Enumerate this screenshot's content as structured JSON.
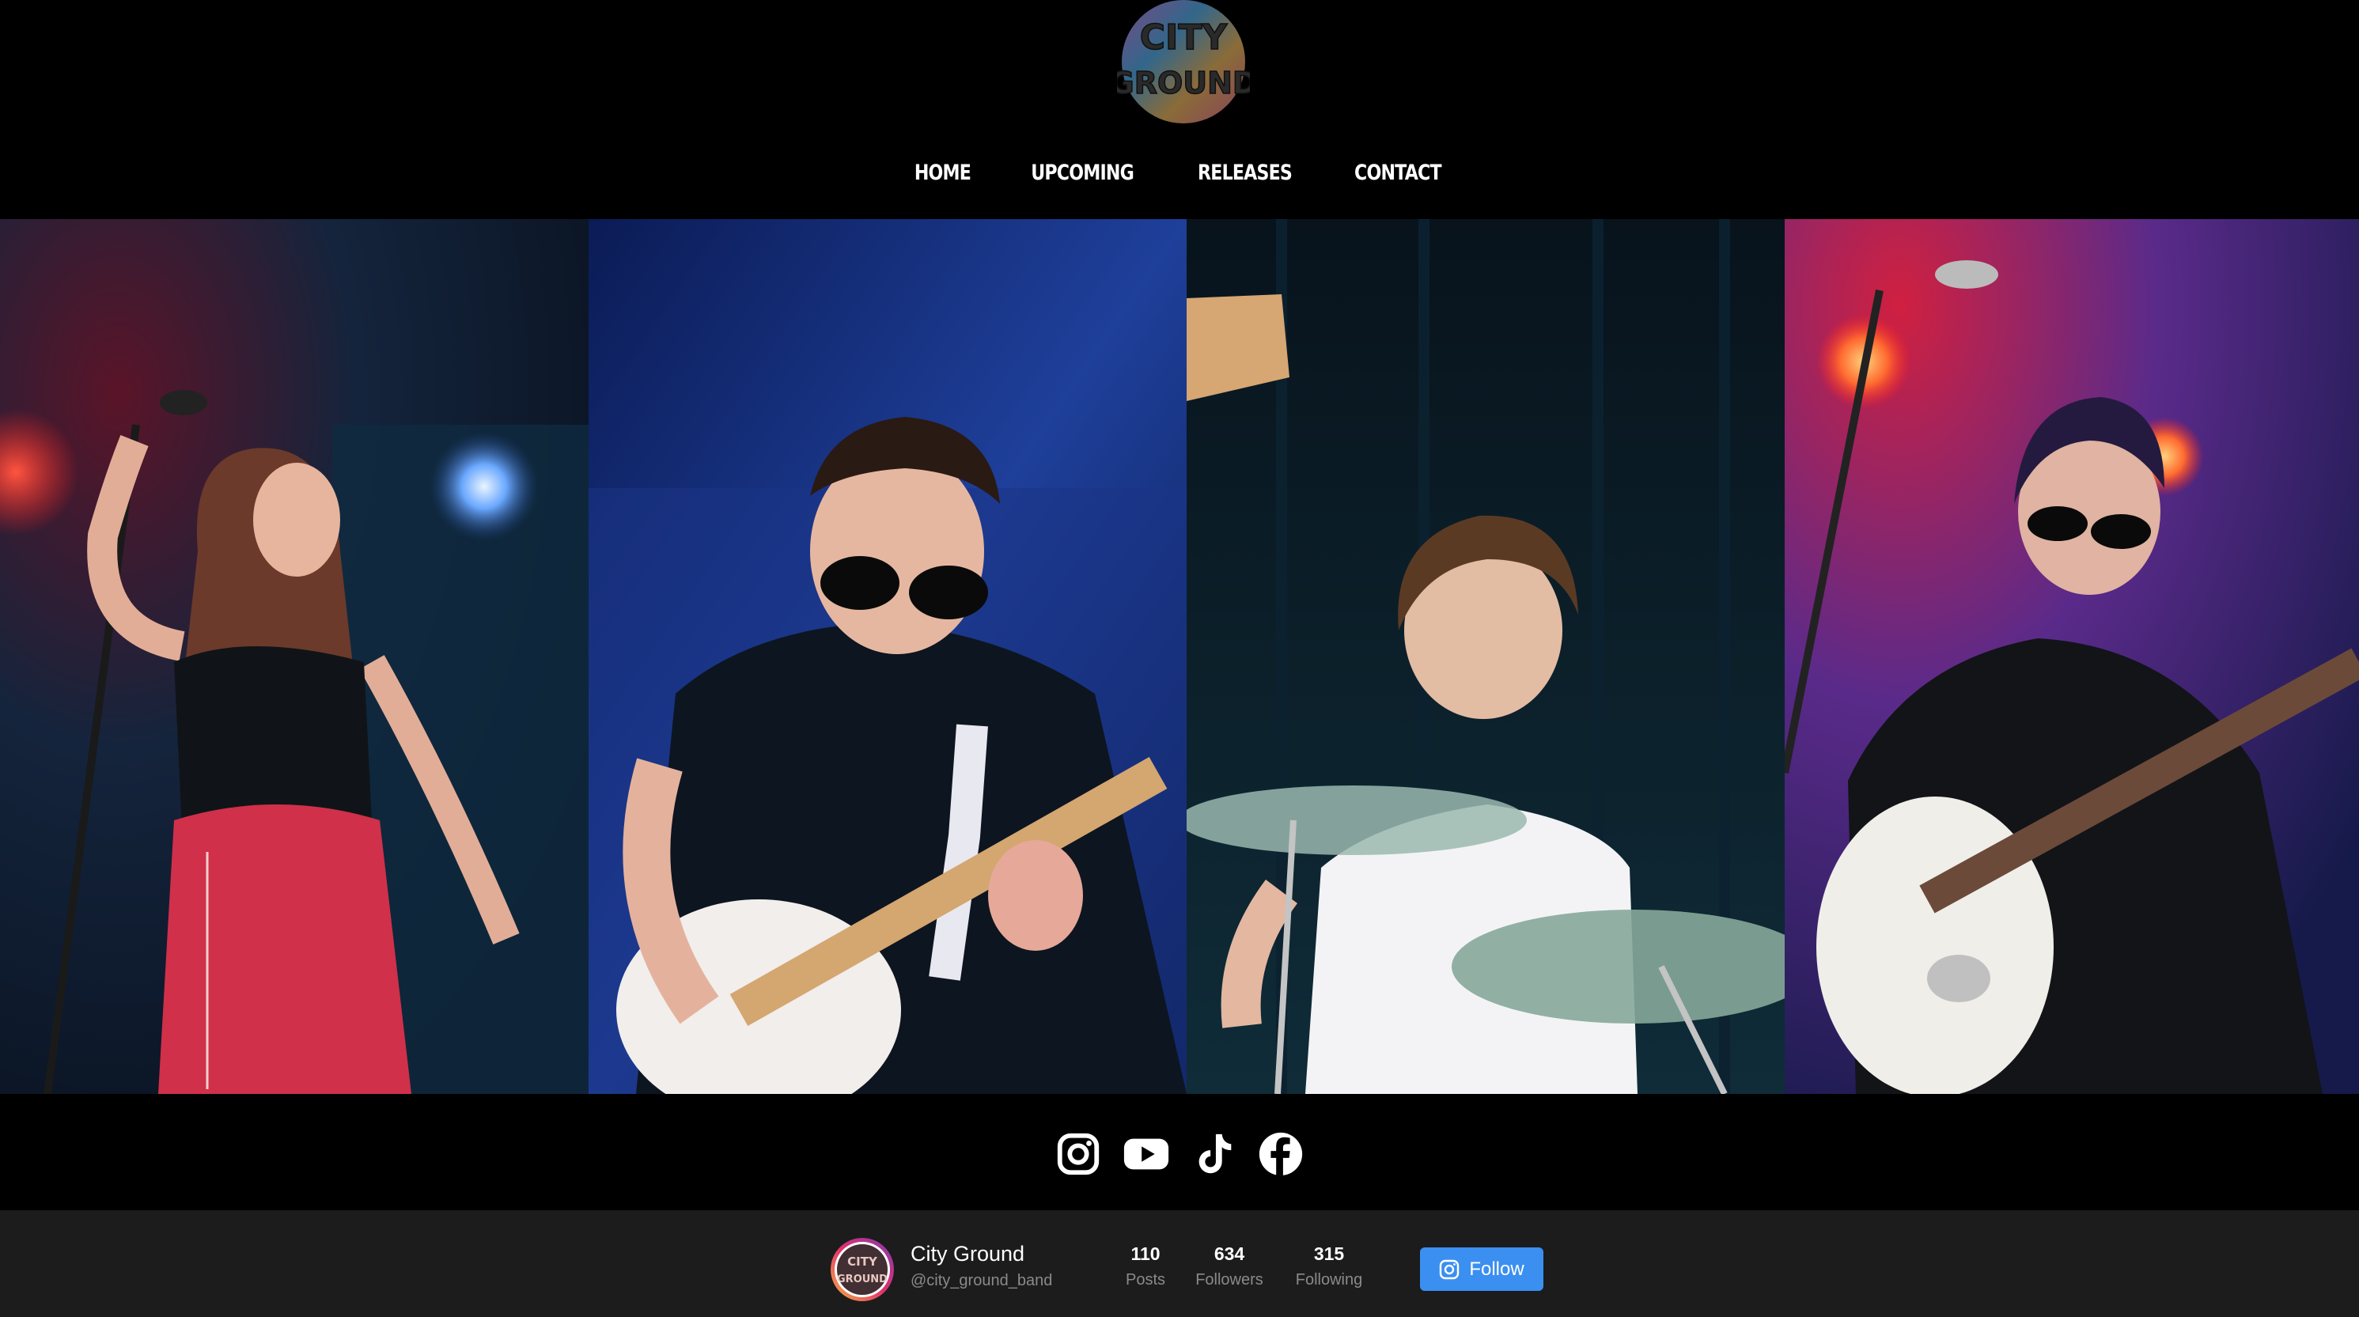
{
  "brand": {
    "logo_text_top": "CITY",
    "logo_text_bottom": "GROUND",
    "logo_icon": "city-ground-psychedelic-logo"
  },
  "nav": {
    "items": [
      {
        "label": "HOME"
      },
      {
        "label": "UPCOMING"
      },
      {
        "label": "RELEASES"
      },
      {
        "label": "CONTACT"
      }
    ]
  },
  "gallery": {
    "photos": [
      {
        "icon": "vocalist-photo"
      },
      {
        "icon": "guitarist-photo"
      },
      {
        "icon": "drummer-photo"
      },
      {
        "icon": "bassist-photo"
      }
    ]
  },
  "social": {
    "icons": [
      "instagram-icon",
      "youtube-icon",
      "tiktok-icon",
      "facebook-icon"
    ]
  },
  "instagram": {
    "name": "City Ground",
    "handle": "@city_ground_band",
    "stats": {
      "posts": {
        "value": "110",
        "label": "Posts"
      },
      "followers": {
        "value": "634",
        "label": "Followers"
      },
      "following": {
        "value": "315",
        "label": "Following"
      }
    },
    "follow_label": "Follow",
    "accent_color": "#3b8ff0"
  },
  "colors": {
    "background": "#000000",
    "footer_bar": "#1c1c1c",
    "nav_text": "#ffffff"
  }
}
